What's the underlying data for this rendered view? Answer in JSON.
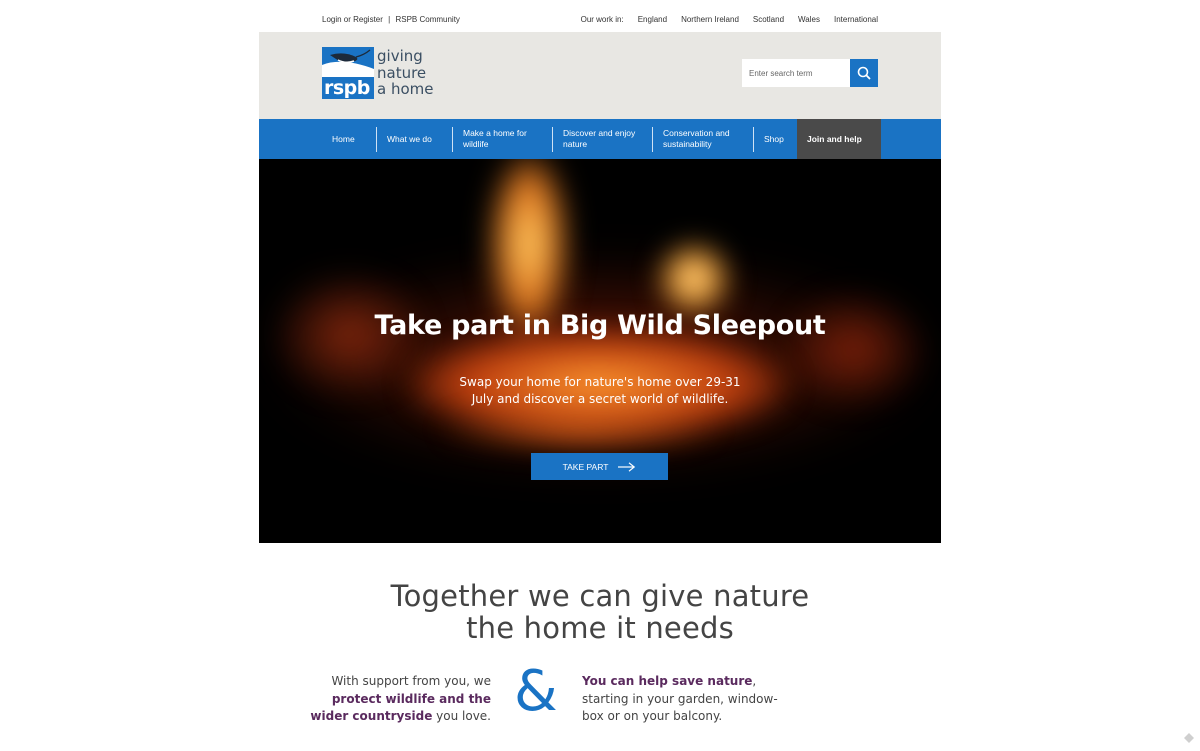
{
  "topbar": {
    "login": "Login or Register",
    "divider": "|",
    "community": "RSPB Community",
    "our_work_label": "Our work in:",
    "regions": [
      "England",
      "Northern Ireland",
      "Scotland",
      "Wales",
      "International"
    ]
  },
  "logo": {
    "mark": "rspb",
    "tagline_1": "giving",
    "tagline_2": "nature",
    "tagline_3": "a home"
  },
  "search": {
    "placeholder": "Enter search term",
    "icon": "search-icon"
  },
  "nav": {
    "items": [
      "Home",
      "What we do",
      "Make a home for wildlife",
      "Discover and enjoy nature",
      "Conservation and sustainability",
      "Shop"
    ],
    "join": "Join and help"
  },
  "hero": {
    "title": "Take part in Big Wild Sleepout",
    "text": "Swap your home for nature's home over 29-31 July and discover a secret world of wildlife.",
    "cta": "TAKE PART",
    "cta_icon": "arrow-right-icon"
  },
  "intro": {
    "heading_1": "Together we can give nature",
    "heading_2": "the home it needs",
    "left_pre": "With support from you, we ",
    "left_em": "protect wildlife and the wider countryside",
    "left_post": " you love.",
    "amp": "&",
    "right_em": "You can help save nature",
    "right_post": ", starting in your garden, window-box or on your balcony."
  },
  "colors": {
    "brand_blue": "#1a73c4",
    "header_bg": "#e8e7e3",
    "join_bg": "#4a4a4a",
    "emphasis": "#5a2a5e"
  }
}
